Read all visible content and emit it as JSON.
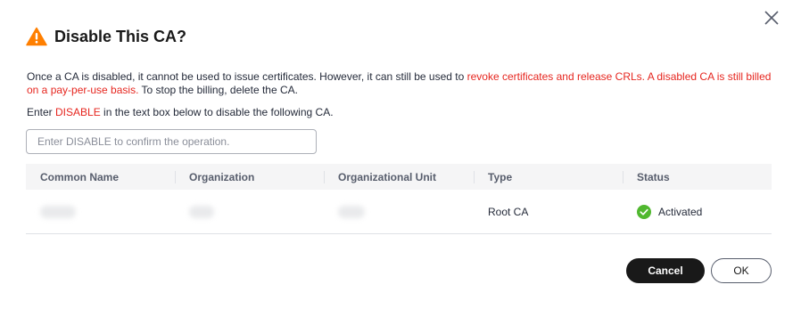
{
  "dialog": {
    "title": "Disable This CA?",
    "warning_icon": "warning-triangle-icon",
    "close_icon": "close-icon",
    "description": {
      "part1": "Once a CA is disabled, it cannot be used to issue certificates. However, it can still be used to ",
      "highlight": "revoke certificates and release CRLs. A disabled CA is still billed on a pay-per-use basis.",
      "part2": " To stop the billing, delete the CA."
    },
    "instruction": {
      "before": "Enter ",
      "keyword": "DISABLE",
      "after": " in the text box below to disable the following CA."
    },
    "input": {
      "value": "",
      "placeholder": "Enter DISABLE to confirm the operation."
    },
    "table": {
      "columns": [
        "Common Name",
        "Organization",
        "Organizational Unit",
        "Type",
        "Status"
      ],
      "rows": [
        {
          "type": "Root CA",
          "status": "Activated"
        }
      ]
    },
    "buttons": {
      "cancel": "Cancel",
      "ok": "OK"
    }
  },
  "colors": {
    "warning": "#ff7f00",
    "danger_text": "#e6261f",
    "success": "#50b82f",
    "primary_button": "#191919"
  }
}
